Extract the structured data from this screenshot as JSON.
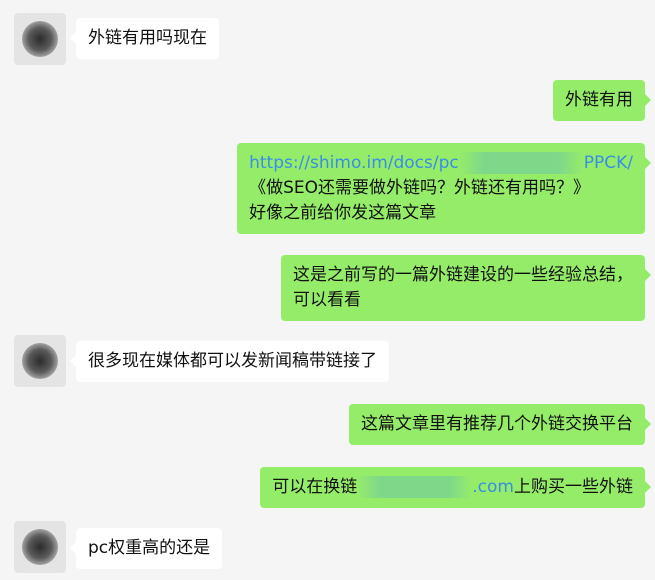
{
  "messages": [
    {
      "side": "incoming",
      "text": "外链有用吗现在"
    },
    {
      "side": "outgoing",
      "text": "外链有用"
    },
    {
      "side": "outgoing",
      "link_start": "https://shimo.im/docs/pc",
      "link_end": "PPCK/",
      "line2": "《做SEO还需要做外链吗？外链还有用吗？》",
      "line3": "好像之前给你发这篇文章"
    },
    {
      "side": "outgoing",
      "line1": "这是之前写的一篇外链建设的一些经验总结，",
      "line2": "可以看看"
    },
    {
      "side": "incoming",
      "text": "很多现在媒体都可以发新闻稿带链接了"
    },
    {
      "side": "outgoing",
      "text": "这篇文章里有推荐几个外链交换平台"
    },
    {
      "side": "outgoing",
      "prefix": "可以在换链",
      "link_suffix": ".com",
      "suffix": "上购买一些外链"
    },
    {
      "side": "incoming",
      "text": "pc权重高的还是"
    }
  ]
}
